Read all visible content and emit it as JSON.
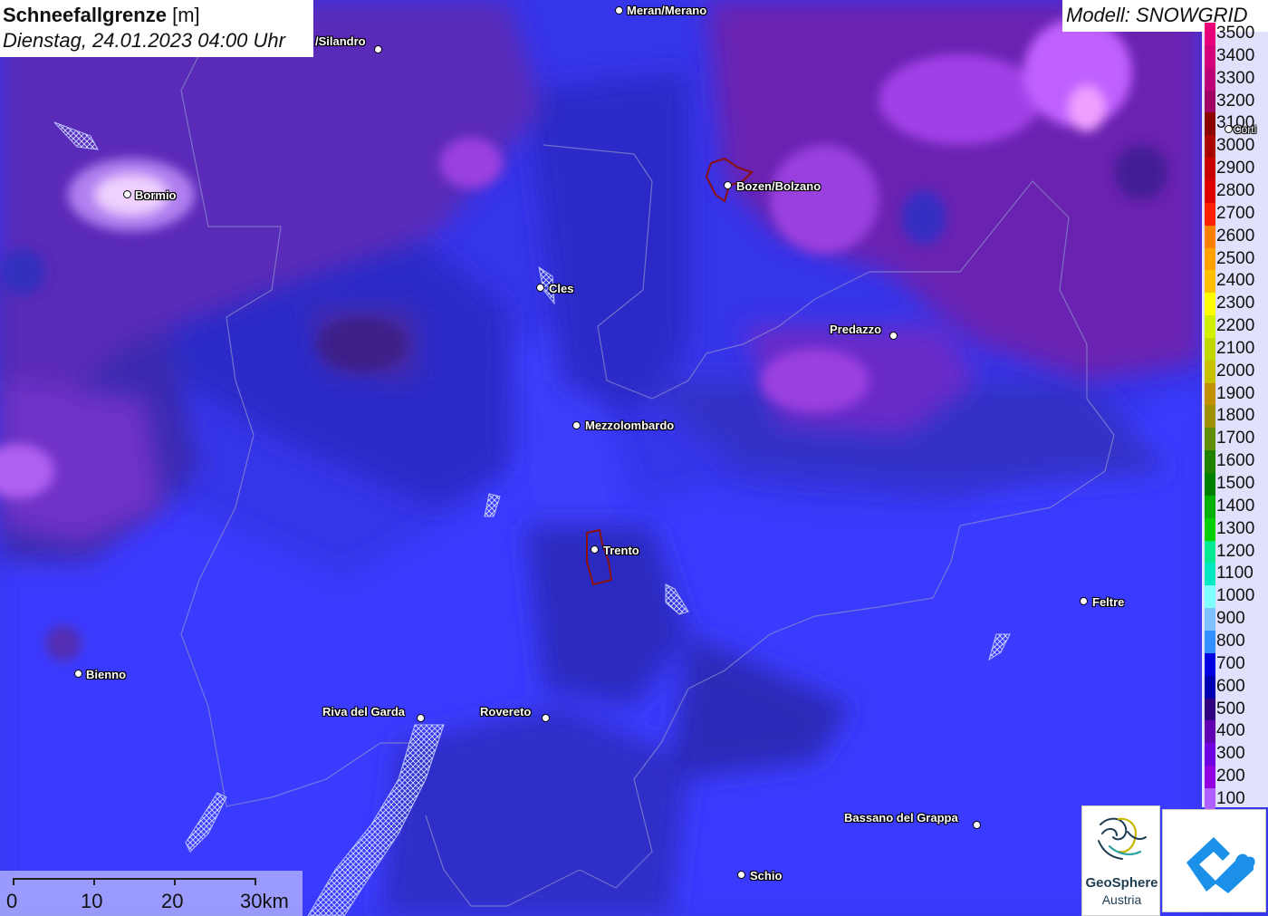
{
  "title": {
    "main": "Schneefallgrenze",
    "unit": "[m]",
    "datetime": "Dienstag, 24.01.2023 04:00 Uhr"
  },
  "model": "Modell: SNOWGRID",
  "legend": [
    {
      "label": "3500",
      "color": "#e8007a"
    },
    {
      "label": "3400",
      "color": "#d4007a"
    },
    {
      "label": "3300",
      "color": "#be0078"
    },
    {
      "label": "3200",
      "color": "#a00066"
    },
    {
      "label": "3100",
      "color": "#8c0000"
    },
    {
      "label": "3000",
      "color": "#aa0000"
    },
    {
      "label": "2900",
      "color": "#c80000"
    },
    {
      "label": "2800",
      "color": "#e00000"
    },
    {
      "label": "2700",
      "color": "#ff2000"
    },
    {
      "label": "2600",
      "color": "#ff8000"
    },
    {
      "label": "2500",
      "color": "#ffa000"
    },
    {
      "label": "2400",
      "color": "#ffc000"
    },
    {
      "label": "2300",
      "color": "#ffff00"
    },
    {
      "label": "2200",
      "color": "#d0f000"
    },
    {
      "label": "2100",
      "color": "#c0d800"
    },
    {
      "label": "2000",
      "color": "#c8c000"
    },
    {
      "label": "1900",
      "color": "#c09000"
    },
    {
      "label": "1800",
      "color": "#a09000"
    },
    {
      "label": "1700",
      "color": "#609000"
    },
    {
      "label": "1600",
      "color": "#208000"
    },
    {
      "label": "1500",
      "color": "#008000"
    },
    {
      "label": "1400",
      "color": "#00b000"
    },
    {
      "label": "1300",
      "color": "#00d000"
    },
    {
      "label": "1200",
      "color": "#00e890"
    },
    {
      "label": "1100",
      "color": "#00e8c0"
    },
    {
      "label": "1000",
      "color": "#80ffff"
    },
    {
      "label": "900",
      "color": "#80c0ff"
    },
    {
      "label": "800",
      "color": "#3090ff"
    },
    {
      "label": "700",
      "color": "#0000e0"
    },
    {
      "label": "600",
      "color": "#0000b0"
    },
    {
      "label": "500",
      "color": "#300080"
    },
    {
      "label": "400",
      "color": "#6000b0"
    },
    {
      "label": "300",
      "color": "#7000e0"
    },
    {
      "label": "200",
      "color": "#9000e0"
    },
    {
      "label": "100",
      "color": "#b060ff"
    }
  ],
  "cities": [
    {
      "name": "Meran/Merano"
    },
    {
      "name": "/Silandro"
    },
    {
      "name": "Bormio"
    },
    {
      "name": "Bozen/Bolzano"
    },
    {
      "name": "Cles"
    },
    {
      "name": "Predazzo"
    },
    {
      "name": "Mezzolombardo"
    },
    {
      "name": "Trento"
    },
    {
      "name": "Feltre"
    },
    {
      "name": "Bienno"
    },
    {
      "name": "Riva del Garda"
    },
    {
      "name": "Rovereto"
    },
    {
      "name": "Bassano del Grappa"
    },
    {
      "name": "Schio"
    },
    {
      "name": "Corti"
    }
  ],
  "scale": {
    "labels": [
      "0",
      "10",
      "20",
      "30km"
    ]
  },
  "logos": {
    "geosphere_line1": "GeoSphere",
    "geosphere_line2": "Austria"
  }
}
